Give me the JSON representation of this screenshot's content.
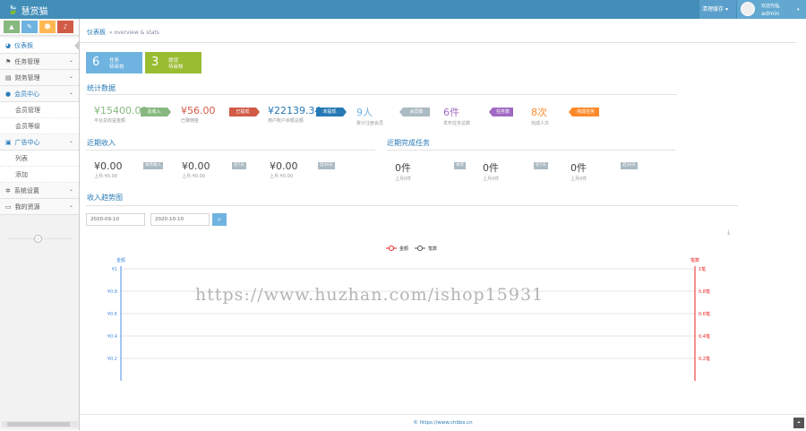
{
  "app": {
    "brand": "慧赏猫"
  },
  "header": {
    "clear_cache": "清理缓存",
    "welcome": "欢迎光临,",
    "username": "admin"
  },
  "sidebar": {
    "shortcut_colors": [
      "#87b87f",
      "#6fb3e0",
      "#ffb752",
      "#d15b47"
    ],
    "items": [
      {
        "label": "仪表板",
        "icon": "dashboard-icon",
        "glyph": "◕"
      },
      {
        "label": "任务管理",
        "icon": "flag-icon",
        "glyph": "⚑"
      },
      {
        "label": "财务管理",
        "icon": "inbox-icon",
        "glyph": "▤"
      },
      {
        "label": "会员中心",
        "icon": "user-icon",
        "glyph": "●"
      },
      {
        "label": "广告中心",
        "icon": "picture-icon",
        "glyph": "▣"
      },
      {
        "label": "系统设置",
        "icon": "gear-icon",
        "glyph": "✲"
      },
      {
        "label": "我的资源",
        "icon": "folder-icon",
        "glyph": "▭"
      }
    ],
    "member_sub": [
      "会员管理",
      "会员等级"
    ],
    "ad_sub": [
      "列表",
      "添加"
    ]
  },
  "breadcrumb": {
    "title": "仪表板",
    "sub": "» overview & stats"
  },
  "info_boxes": [
    {
      "num": "6",
      "l1": "任务",
      "l2": "待审核",
      "color": "#6fb3e0"
    },
    {
      "num": "3",
      "l1": "提现",
      "l2": "待审核",
      "color": "#9abc32"
    }
  ],
  "stats": {
    "title": "统计数据",
    "items": [
      {
        "value": "¥15400.00",
        "desc": "平台总收益金额",
        "tag": "总收入",
        "color": "#87b87f",
        "tagcolor": "#87b87f"
      },
      {
        "value": "¥56.00",
        "desc": "已赚佣金",
        "tag": "已提现",
        "color": "#d15b47",
        "tagcolor": "#d15b47"
      },
      {
        "value": "¥22139.34",
        "desc": "用户账户余额总额",
        "tag": "未提现",
        "color": "#2679b5",
        "tagcolor": "#2679b5"
      },
      {
        "value": "9人",
        "desc": "累计注册会员",
        "tag": "会员数",
        "color": "#6fb3e0",
        "tagcolor": "#abbac3"
      },
      {
        "value": "6件",
        "desc": "发布任务总数",
        "tag": "任务数",
        "color": "#a069c3",
        "tagcolor": "#a069c3"
      },
      {
        "value": "8次",
        "desc": "完成人次",
        "tag": "完成任务",
        "color": "#ff892a",
        "tagcolor": "#ff892a"
      }
    ]
  },
  "recent_income": {
    "title": "近期收入",
    "items": [
      {
        "value": "¥0.00",
        "desc": "上月:¥0.00",
        "tag": "本月收入"
      },
      {
        "value": "¥0.00",
        "desc": "上月:¥0.00",
        "tag": "近7天"
      },
      {
        "value": "¥0.00",
        "desc": "上月:¥0.00",
        "tag": "近30天"
      }
    ]
  },
  "recent_tasks": {
    "title": "近期完成任务",
    "items": [
      {
        "value": "0件",
        "desc": "上月0件",
        "tag": "本月"
      },
      {
        "value": "0件",
        "desc": "上月0件",
        "tag": "近7天"
      },
      {
        "value": "0件",
        "desc": "上月0件",
        "tag": "近30天"
      }
    ]
  },
  "trend": {
    "title": "收入趋势图",
    "date_from": "2020-09-10",
    "date_to": "2020-10-10"
  },
  "chart_data": {
    "type": "line",
    "series": [
      {
        "name": "金额",
        "color": "#ee2222"
      },
      {
        "name": "笔数",
        "color": "#555555"
      }
    ],
    "left_axis": {
      "label": "金额",
      "ticks": [
        "¥1",
        "¥0.8",
        "¥0.6",
        "¥0.4",
        "¥0.2"
      ],
      "color": "#4a90e2"
    },
    "right_axis": {
      "label": "笔数",
      "ticks": [
        "1笔",
        "0.8笔",
        "0.6笔",
        "0.4笔",
        "0.2笔"
      ],
      "color": "#ee2222"
    },
    "ylim": [
      0,
      1
    ],
    "grid": true,
    "legend": "top"
  },
  "watermark": "https://www.huzhan.com/ishop15931",
  "footer": {
    "copyright": "© https://www.chbbs.cn"
  }
}
